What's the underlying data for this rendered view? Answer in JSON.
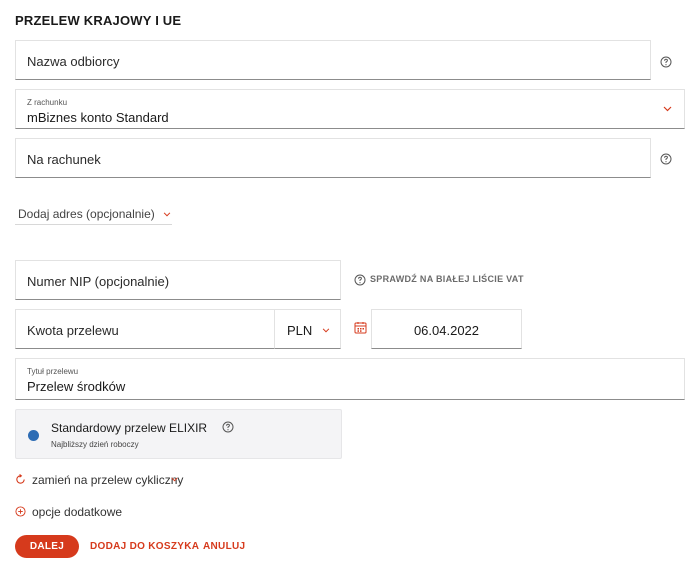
{
  "form": {
    "heading": "PRZELEW KRAJOWY I UE",
    "recipient_name": {
      "placeholder": "Nazwa odbiorcy"
    },
    "from_account": {
      "label": "Z rachunku",
      "value": "mBiznes konto Standard"
    },
    "to_account": {
      "placeholder": "Na rachunek"
    },
    "add_address": "Dodaj adres (opcjonalnie)",
    "nip": {
      "placeholder": "Numer NIP (opcjonalnie)"
    },
    "vat_check_link": "SPRAWDŹ NA BIAŁEJ LIŚCIE VAT",
    "amount": {
      "placeholder": "Kwota przelewu"
    },
    "currency": "PLN",
    "date": "06.04.2022",
    "title": {
      "label": "Tytuł przelewu",
      "value": "Przelew środków"
    },
    "transfer_type": {
      "title": "Standardowy przelew ELIXIR",
      "subtitle": "Najbliższy dzień roboczy"
    },
    "recurring_link": "zamień na przelew cykliczny",
    "extra_options": "opcje dodatkowe",
    "buttons": {
      "next": "DALEJ",
      "add_to_cart": "DODAJ DO KOSZYKA",
      "cancel": "ANULUJ"
    }
  },
  "colors": {
    "accent": "#d63a1c",
    "radio": "#2d6cb4"
  }
}
